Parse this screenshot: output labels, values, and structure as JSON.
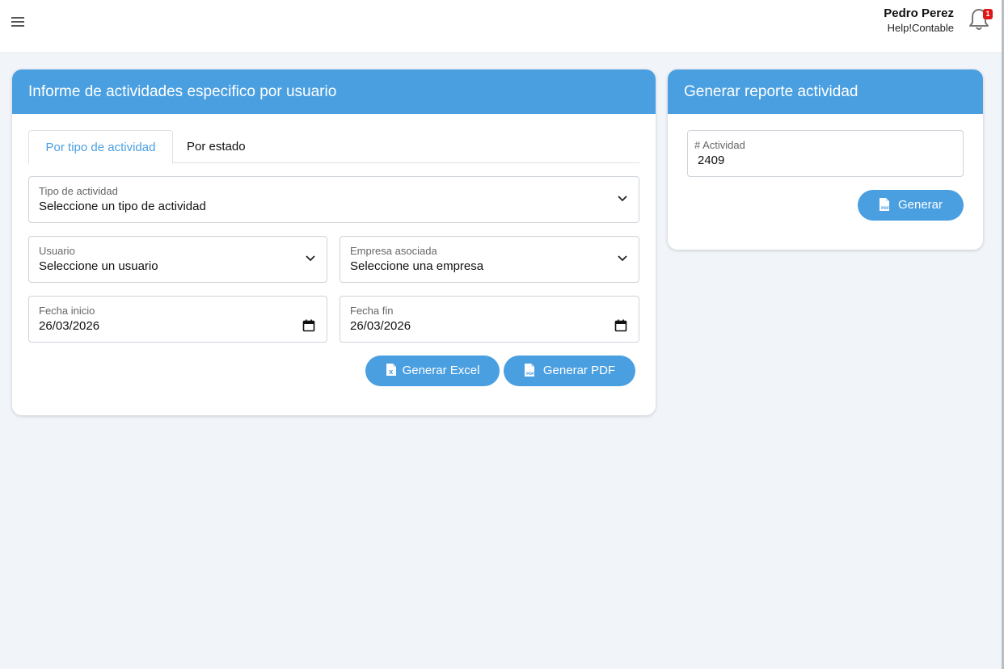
{
  "header": {
    "user_name": "Pedro Perez",
    "company": "Help!Contable",
    "notification_count": "1"
  },
  "left_card": {
    "title": "Informe de actividades especifico por usuario",
    "tabs": [
      {
        "label": "Por tipo de actividad",
        "active": true
      },
      {
        "label": "Por estado",
        "active": false
      }
    ],
    "tipo_actividad": {
      "label": "Tipo de actividad",
      "value": "Seleccione un tipo de actividad"
    },
    "usuario": {
      "label": "Usuario",
      "value": "Seleccione un usuario"
    },
    "empresa": {
      "label": "Empresa asociada",
      "value": "Seleccione una empresa"
    },
    "fecha_inicio": {
      "label": "Fecha inicio",
      "value": "26/03/2026"
    },
    "fecha_fin": {
      "label": "Fecha fin",
      "value": "26/03/2026"
    },
    "btn_excel": "Generar Excel",
    "btn_pdf": "Generar PDF"
  },
  "right_card": {
    "title": "Generar reporte actividad",
    "actividad": {
      "label": "# Actividad",
      "value": "2409"
    },
    "btn_generar": "Generar"
  },
  "colors": {
    "accent": "#4a9fe1",
    "background": "#f1f5f9",
    "badge": "#e01616"
  },
  "icons": [
    "menu-icon",
    "bell-icon",
    "chevron-down-icon",
    "calendar-icon",
    "excel-file-icon",
    "pdf-file-icon"
  ]
}
